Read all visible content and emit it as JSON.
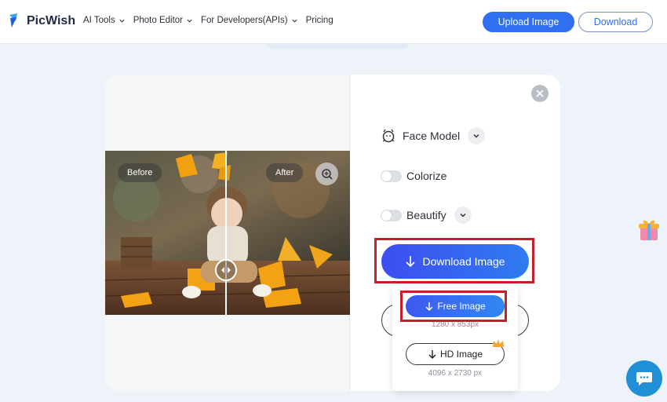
{
  "header": {
    "brand": "PicWish",
    "nav": [
      {
        "label": "AI Tools",
        "has_dropdown": true
      },
      {
        "label": "Photo Editor",
        "has_dropdown": true
      },
      {
        "label": "For Developers(APIs)",
        "has_dropdown": true
      },
      {
        "label": "Pricing",
        "has_dropdown": false
      }
    ],
    "upload_label": "Upload Image",
    "download_label": "Download"
  },
  "preview": {
    "before_label": "Before",
    "after_label": "After"
  },
  "options": {
    "face_model_label": "Face Model",
    "colorize_label": "Colorize",
    "colorize_on": false,
    "beautify_label": "Beautify",
    "beautify_on": false
  },
  "download_button_label": "Download Image",
  "download_menu": {
    "free_label": "Free Image",
    "free_size": "1280 x 853px",
    "hd_label": "HD Image",
    "hd_size": "4096 x 2730 px"
  },
  "colors": {
    "accent": "#2f6ff0",
    "highlight_frame": "#c6202b"
  },
  "icons": [
    "logo-icon",
    "chevron-down-icon",
    "zoom-in-icon",
    "close-icon",
    "face-model-icon",
    "download-arrow-icon",
    "crown-icon",
    "gift-icon",
    "chat-icon"
  ]
}
